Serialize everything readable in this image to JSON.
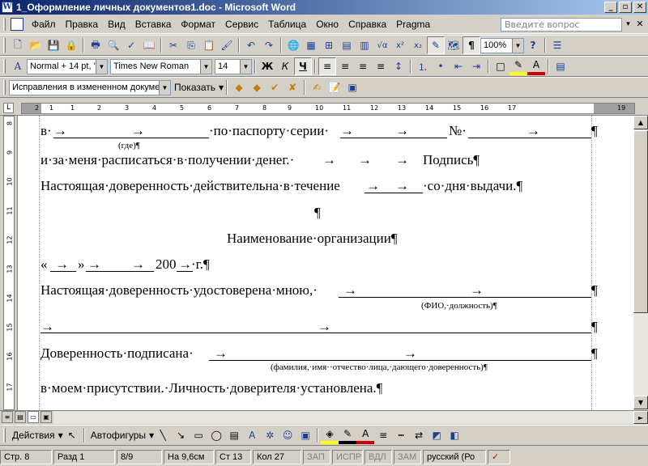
{
  "window": {
    "title": "1_Оформление личных документов1.doc - Microsoft Word",
    "app_icon": "W",
    "minimize": "_",
    "maximize": "▫",
    "close": "✕"
  },
  "menu": {
    "items": [
      "Файл",
      "Правка",
      "Вид",
      "Вставка",
      "Формат",
      "Сервис",
      "Таблица",
      "Окно",
      "Справка",
      "Pragma"
    ],
    "ask_placeholder": "Введите вопрос",
    "ask_arrow": "▾",
    "doc_close": "✕"
  },
  "standard_toolbar": {
    "icons": [
      "new-icon",
      "open-icon",
      "save-icon",
      "permission-icon",
      "print-icon",
      "print-preview-icon",
      "spelling-icon",
      "research-icon",
      "cut-icon",
      "copy-icon",
      "paste-icon",
      "format-painter-icon",
      "undo-icon",
      "redo-icon",
      "hyperlink-icon",
      "tables-borders-icon",
      "insert-table-icon",
      "insert-excel-icon",
      "columns-icon",
      "equation-icon",
      "superscript-icon",
      "subscript-icon",
      "drawing-icon",
      "document-map-icon",
      "show-formatting-icon",
      "zoom-icon",
      "help-icon",
      "read-icon"
    ],
    "glyphs": {
      "new": "🗋",
      "open": "📂",
      "save": "💾",
      "permission": "🔒",
      "print": "🖶",
      "preview": "🔍",
      "spelling": "✓",
      "research": "📖",
      "cut": "✂",
      "copy": "⎘",
      "paste": "📋",
      "painter": "🖌",
      "undo": "↶",
      "redo": "↷",
      "hyperlink": "🌐",
      "tables": "▦",
      "table": "⊞",
      "excel": "▤",
      "columns": "▥",
      "equation": "√α",
      "sup": "x²",
      "sub": "x₂",
      "drawing": "✎",
      "map": "🗺",
      "pilcrow": "¶",
      "help": "?",
      "read": "☰"
    },
    "zoom": "100%"
  },
  "formatting_toolbar": {
    "style": "Normal + 14 pt, '",
    "font": "Times New Roman",
    "size": "14",
    "bold": "Ж",
    "italic": "К",
    "underline": "Ч",
    "glyphs": {
      "styles": "A",
      "align_left": "≡",
      "center": "≡",
      "right": "≡",
      "justify": "≡",
      "spacing": "↕",
      "numbering": "⒈",
      "bullets": "•",
      "outdent": "⇤",
      "indent": "⇥",
      "border": "□",
      "highlight": "✎",
      "font_color": "A",
      "research": "▤"
    }
  },
  "reviewing_toolbar": {
    "display": "Исправления в измененном документ",
    "show_label": "Показать",
    "glyphs": {
      "prev": "◆",
      "next": "◆",
      "accept": "✔",
      "reject": "✘",
      "comment": "✍",
      "track": "📝",
      "pane": "▣"
    }
  },
  "ruler": {
    "corner": "L",
    "numbers": [
      "2",
      "1",
      "1",
      "2",
      "3",
      "4",
      "5",
      "6",
      "7",
      "8",
      "9",
      "10",
      "11",
      "12",
      "13",
      "14",
      "15",
      "16",
      "17",
      "19"
    ],
    "vertical_numbers": [
      "8",
      "9",
      "10",
      "11",
      "12",
      "13",
      "14",
      "15",
      "16",
      "17"
    ]
  },
  "document": {
    "line1_start": "в·",
    "line1_mid": "·по·паспорту·серии·",
    "line1_no": "№·",
    "line1_end": "¶",
    "where": "(где)¶",
    "line2": "и·за·меня·расписаться·в·получении·денег.·",
    "line2_sig": "Подпись¶",
    "line3": "Настоящая·доверенность·действительна·в·течение",
    "line3_end": "·со·дня·выдачи.¶",
    "empty_para": "¶",
    "org": "Наименование·организации¶",
    "date_open": "«",
    "date_close": "»",
    "date_year": "200",
    "date_end": "·г.¶",
    "cert": "Настоящая·доверенность·удостоверена·мною,·",
    "cert_end": "¶",
    "fio": "(ФИО,·должность)¶",
    "blank_end": "¶",
    "signed": "Доверенность·подписана·",
    "signed_end": "¶",
    "family": "(фамилия,·имя··отчество·лица,·дающего·доверенность)¶",
    "presence": "в·моем·присутствии.·Личность·доверителя·установлена.¶",
    "tab": "→"
  },
  "scrollbar": {
    "up": "▲",
    "down": "▼"
  },
  "view_buttons": [
    "≡",
    "▤",
    "▭",
    "▣",
    "▦"
  ],
  "drawing_toolbar": {
    "actions": "Действия",
    "autoshapes": "Автофигуры",
    "glyphs": {
      "select": "↖",
      "line": "╲",
      "arrow": "↘",
      "rect": "▭",
      "oval": "◯",
      "textbox": "▤",
      "wordart": "A",
      "diagram": "✲",
      "clipart": "☺",
      "picture": "▣",
      "fill": "◈",
      "linecolor": "✎",
      "fontcolor": "A",
      "linestyle": "≡",
      "dash": "┅",
      "arrowstyle": "⇄",
      "shadow": "◩",
      "threed": "◧"
    }
  },
  "status": {
    "page": "Стр. 8",
    "section": "Разд 1",
    "pages": "8/9",
    "at": "На 9,6см",
    "line": "Ст 13",
    "col": "Кол 27",
    "rec": "ЗАП",
    "trk": "ИСПР",
    "ext": "ВДЛ",
    "ovr": "ЗАМ",
    "lang": "русский (Ро",
    "spell_icon": "✓"
  },
  "colors": {
    "title_start": "#0a246a",
    "title_end": "#a6caf0",
    "chrome": "#d4d0c8",
    "highlight": "#ffff00",
    "font_red": "#cc0000"
  }
}
